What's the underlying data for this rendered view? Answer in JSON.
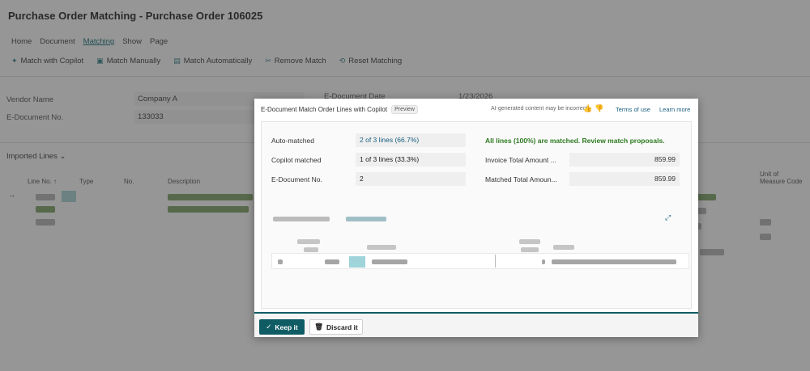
{
  "page": {
    "title": "Purchase Order Matching - Purchase Order 106025"
  },
  "menu": {
    "items": [
      "Home",
      "Document",
      "Matching",
      "Show",
      "Page"
    ]
  },
  "actions": {
    "items": [
      {
        "label": "Match with Copilot",
        "icon": "copilot-icon"
      },
      {
        "label": "Match Manually",
        "icon": "match-manual-icon"
      },
      {
        "label": "Match Automatically",
        "icon": "match-auto-icon"
      },
      {
        "label": "Remove Match",
        "icon": "remove-match-icon"
      },
      {
        "label": "Reset Matching",
        "icon": "reset-icon"
      }
    ]
  },
  "header": {
    "vendor_name_label": "Vendor Name",
    "vendor_name_value": "Company A",
    "edoc_no_label": "E-Document No.",
    "edoc_no_value": "133033",
    "edoc_date_label": "E-Document Date",
    "edoc_date_value": "1/23/2026"
  },
  "imported_lines": {
    "title": "Imported Lines",
    "columns": [
      "Line No. ↑",
      "Type",
      "No.",
      "Description"
    ],
    "right_col": "Unit of Measure Code"
  },
  "dialog": {
    "title": "E-Document Match Order Lines with Copilot",
    "badge": "Preview",
    "ai_note": "AI-generated content may be incorrect",
    "terms": "Terms of use",
    "learn_more": "Learn more",
    "stats_left": [
      {
        "label": "Auto-matched",
        "value": "2 of 3 lines (66.7%)"
      },
      {
        "label": "Copilot matched",
        "value": "1 of 3 lines (33.3%)"
      },
      {
        "label": "E-Document No.",
        "value": "2"
      }
    ],
    "matched_message": "All lines (100%) are matched. Review match proposals.",
    "stats_right": [
      {
        "label": "Invoice Total Amount ...",
        "value": "859.99"
      },
      {
        "label": "Matched Total Amoun...",
        "value": "859.99"
      }
    ],
    "keep_label": "Keep it",
    "discard_label": "Discard it"
  }
}
